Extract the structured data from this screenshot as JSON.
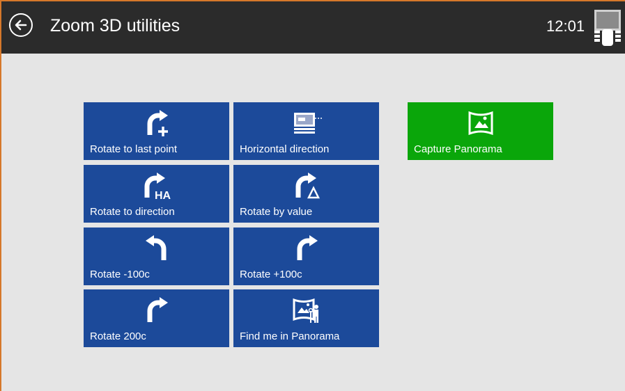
{
  "header": {
    "title": "Zoom 3D utilities",
    "clock": "12:01"
  },
  "colors": {
    "header_bg": "#2b2b2b",
    "background": "#e5e5e5",
    "tile_blue": "#1c4a9a",
    "tile_green": "#0aa60a",
    "accent_border": "#d6782a"
  },
  "tiles": [
    {
      "label": "Rotate to last point",
      "icon": "rotate-plus-icon"
    },
    {
      "label": "Horizontal direction",
      "icon": "instrument-screen-icon"
    },
    {
      "label": "Rotate to direction",
      "icon": "rotate-ha-icon"
    },
    {
      "label": "Rotate by value",
      "icon": "rotate-delta-icon"
    },
    {
      "label": "Rotate -100c",
      "icon": "rotate-left-icon"
    },
    {
      "label": "Rotate +100c",
      "icon": "rotate-right-icon"
    },
    {
      "label": "Rotate 200c",
      "icon": "rotate-right-icon"
    },
    {
      "label": "Find me in Panorama",
      "icon": "panorama-person-icon"
    },
    {
      "label": "Capture Panorama",
      "icon": "panorama-icon"
    }
  ]
}
